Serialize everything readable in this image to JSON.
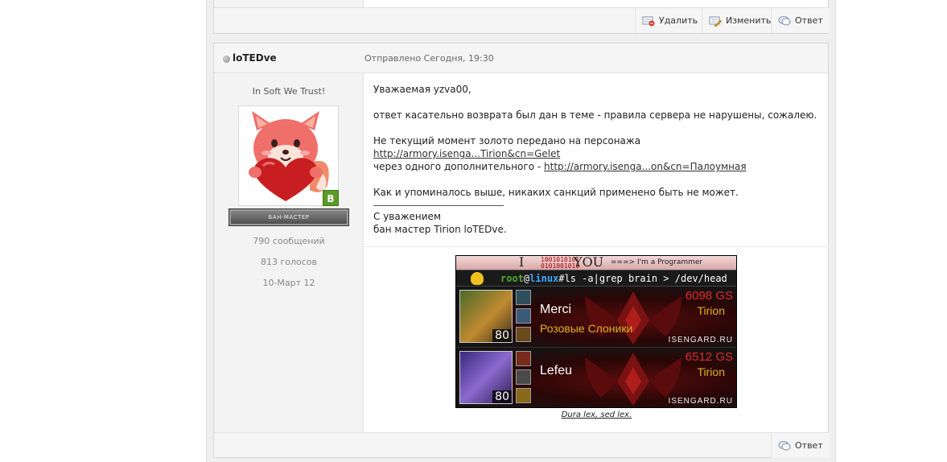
{
  "prev_post": {
    "actions": [
      {
        "label": "Удалить",
        "icon": "delete-icon"
      },
      {
        "label": "Изменить",
        "icon": "edit-icon"
      },
      {
        "label": "Ответ",
        "icon": "reply-icon"
      }
    ]
  },
  "post": {
    "author": "loTEDve",
    "posted": "Отправлено Сегодня, 19:30",
    "motto": "In Soft We Trust!",
    "badge": "B",
    "rank": "БАН-МАСТЕР",
    "stats": [
      "790 сообщений",
      "813 голосов",
      "10-Март 12"
    ],
    "message": {
      "greeting": "Уважаемая yzva00,",
      "line1": "ответ касательно возврата был дан в теме - правила сервера не нарушены, сожалею.",
      "line2_text": "Не текущий момент золото передано на персонажа ",
      "line2_link": "http://armory.isenga...Tirion&cn=Gelet",
      "line3_text": "через одного дополнительного - ",
      "line3_link": "http://armory.isenga...on&cn=Палоумная",
      "line4": "Как и упоминалось выше, никаких санкций применено быть не может.",
      "sign1": "С уважением",
      "sign2": "бан мастер Tirion loTEDve."
    },
    "signature": {
      "top_big1": "I",
      "top_bin": "1001010101 0101001010",
      "top_big2": "YOU",
      "top_prog": "===> I'm a Programmer",
      "term_user": "root",
      "term_at": "@",
      "term_host": "linux",
      "term_cmd": "#ls -a|grep brain > /dev/head",
      "chars": [
        {
          "name": "Merci",
          "guild": "Розовые Слоники",
          "gs": "6098 GS",
          "realm": "Tirion",
          "level": "80",
          "site": "ISENGARD.RU"
        },
        {
          "name": "Lefeu",
          "guild": "",
          "gs": "6512 GS",
          "realm": "Tirion",
          "level": "80",
          "site": "ISENGARD.RU"
        }
      ],
      "caption": "Dura lex, sed lex."
    },
    "reply_label": "Ответ"
  }
}
